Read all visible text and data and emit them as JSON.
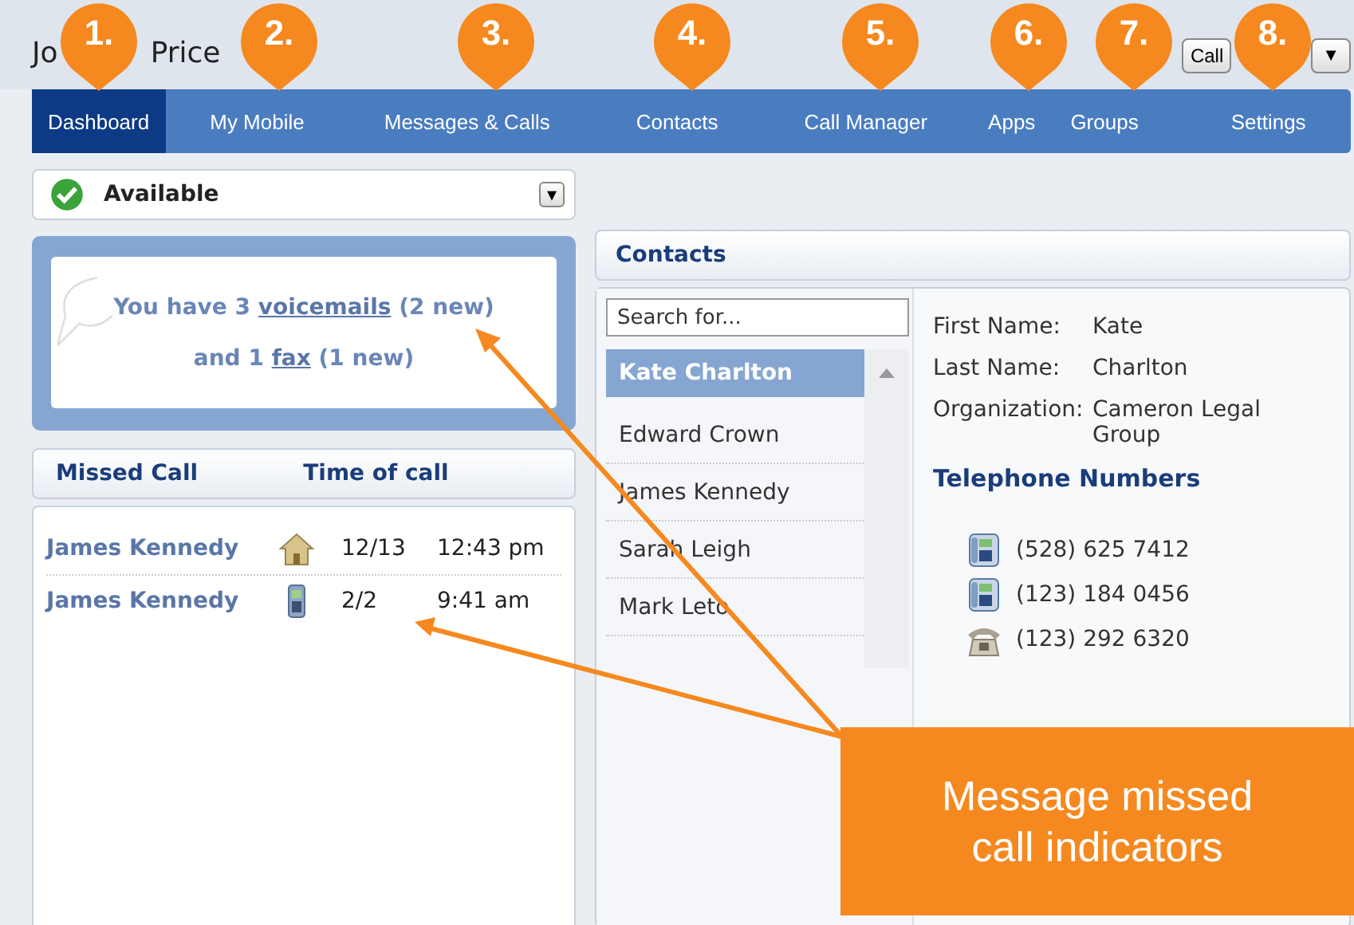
{
  "header": {
    "user_name_parts": [
      "Jo",
      "Price"
    ],
    "call_button": "Call",
    "menu_button": "▼"
  },
  "nav": [
    {
      "label": "Dashboard",
      "selected": true
    },
    {
      "label": "My Mobile",
      "selected": false
    },
    {
      "label": "Messages & Calls",
      "selected": false
    },
    {
      "label": "Contacts",
      "selected": false
    },
    {
      "label": "Call Manager",
      "selected": false
    },
    {
      "label": "Apps",
      "selected": false
    },
    {
      "label": "Groups",
      "selected": false
    },
    {
      "label": "Settings",
      "selected": false
    }
  ],
  "status": {
    "label": "Available",
    "caret": "▾"
  },
  "messages": {
    "line_1": [
      "You have 3 ",
      "voicemails",
      " (2 new)"
    ],
    "line_2": [
      "and 1 ",
      "fax",
      " (1 new)"
    ]
  },
  "missed_calls": {
    "columns": [
      "Missed Call",
      "Time of call"
    ],
    "rows": [
      {
        "name": "James Kennedy",
        "kind": "home",
        "date": "12/13",
        "time": "12:43 pm"
      },
      {
        "name": "James Kennedy",
        "kind": "mobile",
        "date": "2/2",
        "time": "9:41 am"
      }
    ]
  },
  "contacts": {
    "title": "Contacts",
    "search": {
      "placeholder": "Search for..."
    },
    "list": [
      {
        "name": "Kate Charlton",
        "selected": true
      },
      {
        "name": "Edward Crown",
        "selected": false
      },
      {
        "name": "James Kennedy",
        "selected": false
      },
      {
        "name": "Sarah Leigh",
        "selected": false
      },
      {
        "name": "Mark Leto",
        "selected": false
      }
    ],
    "details": [
      {
        "label": "First Name:",
        "value": "Kate"
      },
      {
        "label": "Last Name:",
        "value": "Charlton"
      },
      {
        "label": "Organization:",
        "value": "Cameron Legal Group"
      }
    ],
    "phones_title": "Telephone Numbers",
    "phones": [
      {
        "kind": "desk",
        "number": "(528) 625 7412"
      },
      {
        "kind": "desk",
        "number": "(123) 184 0456"
      },
      {
        "kind": "landline",
        "number": "(123) 292 6320"
      }
    ]
  },
  "annotations": {
    "markers": [
      "1.",
      "2.",
      "3.",
      "4.",
      "5.",
      "6.",
      "7.",
      "8."
    ],
    "callout": "Message missed call indicators"
  }
}
